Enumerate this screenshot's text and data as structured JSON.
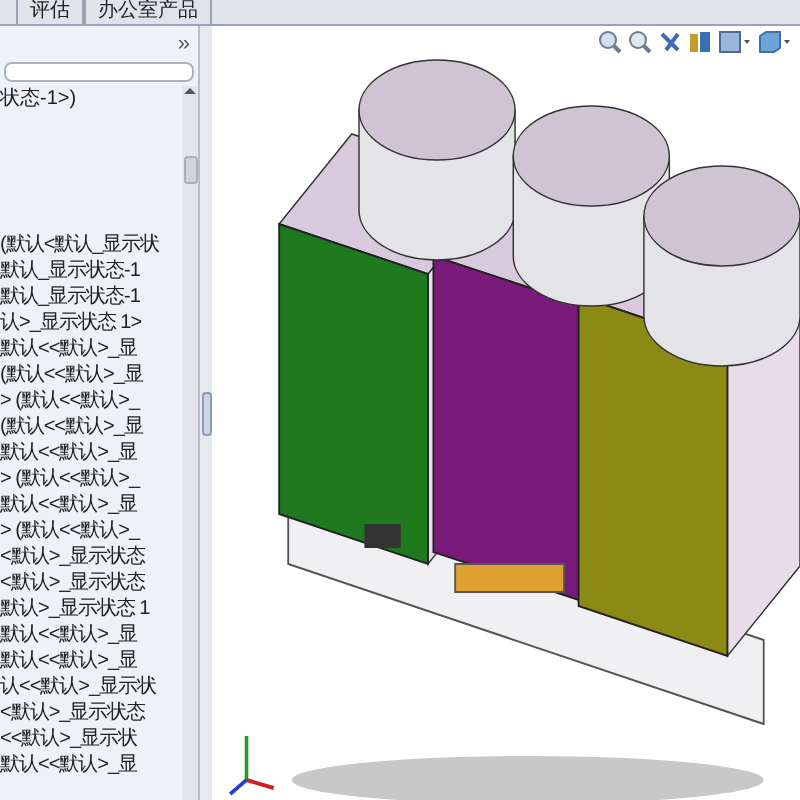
{
  "tabs": [
    {
      "label": "评估",
      "selected": false
    },
    {
      "label": "办公室产品",
      "selected": false
    }
  ],
  "panel": {
    "expand_glyph": "»"
  },
  "tree": {
    "root": "状态-1>)",
    "items": [
      "(默认<默认_显示状",
      "默认_显示状态-1",
      "默认_显示状态-1",
      "认>_显示状态 1>",
      "默认<<默认>_显",
      "(默认<<默认>_显",
      "> (默认<<默认>_",
      "(默认<<默认>_显",
      "默认<<默认>_显",
      "> (默认<<默认>_",
      "默认<<默认>_显",
      "> (默认<<默认>_",
      "<默认>_显示状态",
      "<默认>_显示状态",
      "默认>_显示状态 1",
      "默认<<默认>_显",
      "默认<<默认>_显",
      "认<<默认>_显示状",
      "<默认>_显示状态",
      "<<默认>_显示状",
      "默认<<默认>_显"
    ]
  }
}
